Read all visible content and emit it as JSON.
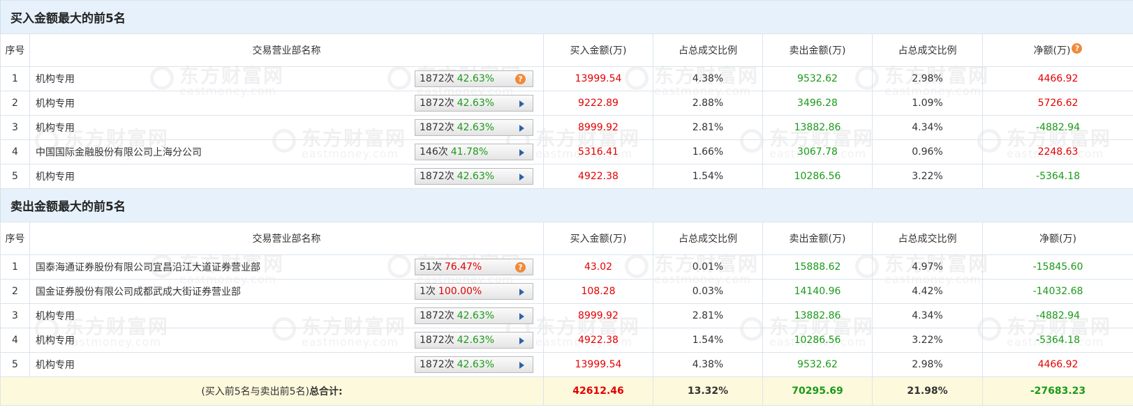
{
  "buy_section": {
    "title": "买入金额最大的前5名",
    "headers": [
      "序号",
      "交易营业部名称",
      "买入金额(万)",
      "占总成交比例",
      "卖出金额(万)",
      "占总成交比例",
      "净额(万)"
    ],
    "rows": [
      {
        "idx": "1",
        "name": "机构专用",
        "times": "1872次",
        "rate": "42.63%",
        "buy": "13999.54",
        "buy_pct": "4.38%",
        "sell": "9532.62",
        "sell_pct": "2.98%",
        "net": "4466.92"
      },
      {
        "idx": "2",
        "name": "机构专用",
        "times": "1872次",
        "rate": "42.63%",
        "buy": "9222.89",
        "buy_pct": "2.88%",
        "sell": "3496.28",
        "sell_pct": "1.09%",
        "net": "5726.62"
      },
      {
        "idx": "3",
        "name": "机构专用",
        "times": "1872次",
        "rate": "42.63%",
        "buy": "8999.92",
        "buy_pct": "2.81%",
        "sell": "13882.86",
        "sell_pct": "4.34%",
        "net": "-4882.94"
      },
      {
        "idx": "4",
        "name": "中国国际金融股份有限公司上海分公司",
        "times": "146次",
        "rate": "41.78%",
        "buy": "5316.41",
        "buy_pct": "1.66%",
        "sell": "3067.78",
        "sell_pct": "0.96%",
        "net": "2248.63"
      },
      {
        "idx": "5",
        "name": "机构专用",
        "times": "1872次",
        "rate": "42.63%",
        "buy": "4922.38",
        "buy_pct": "1.54%",
        "sell": "10286.56",
        "sell_pct": "3.22%",
        "net": "-5364.18"
      }
    ]
  },
  "sell_section": {
    "title": "卖出金额最大的前5名",
    "headers": [
      "序号",
      "交易营业部名称",
      "买入金额(万)",
      "占总成交比例",
      "卖出金额(万)",
      "占总成交比例",
      "净额(万)"
    ],
    "rows": [
      {
        "idx": "1",
        "name": "国泰海通证券股份有限公司宜昌沿江大道证券营业部",
        "times": "51次",
        "rate": "76.47%",
        "buy": "43.02",
        "buy_pct": "0.01%",
        "sell": "15888.62",
        "sell_pct": "4.97%",
        "net": "-15845.60"
      },
      {
        "idx": "2",
        "name": "国金证券股份有限公司成都武成大街证券营业部",
        "times": "1次",
        "rate": "100.00%",
        "buy": "108.28",
        "buy_pct": "0.03%",
        "sell": "14140.96",
        "sell_pct": "4.42%",
        "net": "-14032.68"
      },
      {
        "idx": "3",
        "name": "机构专用",
        "times": "1872次",
        "rate": "42.63%",
        "buy": "8999.92",
        "buy_pct": "2.81%",
        "sell": "13882.86",
        "sell_pct": "4.34%",
        "net": "-4882.94"
      },
      {
        "idx": "4",
        "name": "机构专用",
        "times": "1872次",
        "rate": "42.63%",
        "buy": "4922.38",
        "buy_pct": "1.54%",
        "sell": "10286.56",
        "sell_pct": "3.22%",
        "net": "-5364.18"
      },
      {
        "idx": "5",
        "name": "机构专用",
        "times": "1872次",
        "rate": "42.63%",
        "buy": "13999.54",
        "buy_pct": "4.38%",
        "sell": "9532.62",
        "sell_pct": "2.98%",
        "net": "4466.92"
      }
    ]
  },
  "total": {
    "label_prefix": "(买入前5名与卖出前5名)",
    "label_bold": "总合计:",
    "buy": "42612.46",
    "buy_pct": "13.32%",
    "sell": "70295.69",
    "sell_pct": "21.98%",
    "net": "-27683.23"
  },
  "watermark": {
    "cn": "东方财富网",
    "en": "eastmoney.com"
  },
  "help_icon_glyph": "?",
  "colors": {
    "positive": "#e30000",
    "negative": "#1a9a1a",
    "section_bg": "#e6f1fb",
    "total_bg": "#fdf9dc"
  }
}
